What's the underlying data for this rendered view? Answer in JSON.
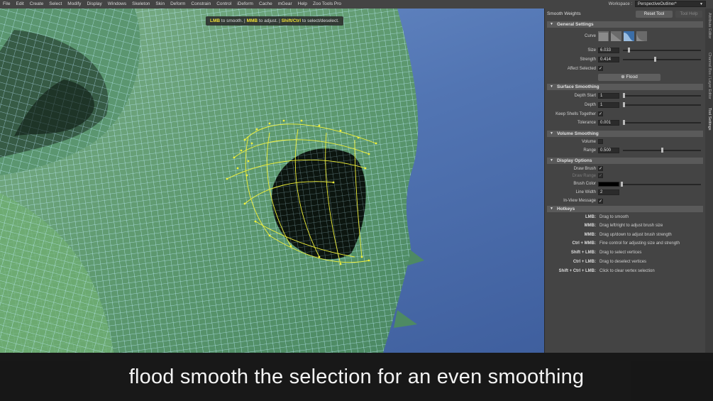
{
  "menu": [
    "File",
    "Edit",
    "Create",
    "Select",
    "Modify",
    "Display",
    "Windows",
    "Skeleton",
    "Skin",
    "Deform",
    "Constrain",
    "Control",
    "iDeform",
    "Cache",
    "mGear",
    "Help",
    "Zoo Tools Pro"
  ],
  "workspace": {
    "label": "Workspace :",
    "value": "PerspectiveOutliner*"
  },
  "inview_message": {
    "k1": "LMB",
    "t1": " to smooth. | ",
    "k2": "MMB",
    "t2": " to adjust. | ",
    "k3": "Shift/Ctrl",
    "t3": " to select/deselect."
  },
  "panel": {
    "title": "Smooth Weights",
    "reset_tool": "Reset Tool",
    "tool_help": "Tool Help",
    "general": {
      "header": "General Settings",
      "curve_label": "Curve",
      "size_label": "Size",
      "size": "6.033",
      "size_level": 0.07,
      "strength_label": "Strength",
      "strength": "0.414",
      "strength_level": 0.41,
      "affect_selected_label": "Affect Selected",
      "affect_selected": "✓",
      "flood": "Flood"
    },
    "surface": {
      "header": "Surface Smoothing",
      "depth_start_label": "Depth Start",
      "depth_start": "1",
      "depth_start_level": 0.0,
      "depth_label": "Depth",
      "depth": "1",
      "depth_level": 0.0,
      "keep_shells_label": "Keep Shells Together",
      "keep_shells": "✓",
      "tolerance_label": "Tolerance",
      "tolerance": "0.001",
      "tolerance_level": 0.0
    },
    "volume": {
      "header": "Volume Smoothing",
      "volume_label": "Volume",
      "volume": "",
      "range_label": "Range",
      "range": "0.500",
      "range_level": 0.5
    },
    "display": {
      "header": "Display Options",
      "draw_brush_label": "Draw Brush",
      "draw_brush": "✓",
      "draw_range_label": "Draw Range",
      "draw_range": "✓",
      "brush_color_label": "Brush Color",
      "brush_color": "#000000",
      "line_width_label": "Line Width",
      "line_width": "2",
      "inview_label": "In-View Message",
      "inview": "✓"
    },
    "hotkeys": {
      "header": "Hotkeys",
      "items": [
        {
          "key": "LMB:",
          "desc": "Drag to smooth"
        },
        {
          "key": "MMB:",
          "desc": "Drag left/right to adjust brush size"
        },
        {
          "key": "MMB:",
          "desc": "Drag up/down to adjust brush strength"
        },
        {
          "key": "Ctrl + MMB:",
          "desc": "Fine control for adjusting size and strength"
        },
        {
          "key": "Shift + LMB:",
          "desc": "Drag to select vertices"
        },
        {
          "key": "Ctrl + LMB:",
          "desc": "Drag to deselect vertices"
        },
        {
          "key": "Shift + Ctrl + LMB:",
          "desc": "Click to clear vertex selection"
        }
      ]
    }
  },
  "side_tabs": [
    "Attribute Editor",
    "Channel Box / Layer Editor",
    "Tool Settings"
  ],
  "caption": "flood smooth the selection for an even smoothing",
  "colors": {
    "selection": "#f2f23a",
    "wire": "#bff0ff",
    "viewport_bg": "#5275b3"
  }
}
